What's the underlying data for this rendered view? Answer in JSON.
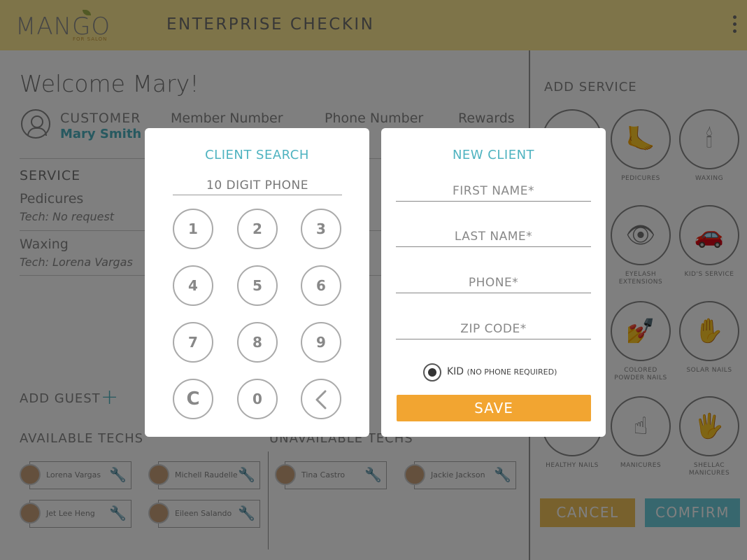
{
  "header": {
    "logo_text": "MANGO",
    "logo_sub": "FOR SALON",
    "title": "ENTERPRISE CHECKIN",
    "menu_icon": "kebab-menu-icon"
  },
  "main": {
    "welcome": "Welcome Mary!",
    "customer_label": "CUSTOMER",
    "customer_name": "Mary Smith",
    "columns": [
      "Member Number",
      "Phone Number",
      "Rewards"
    ],
    "service_header": "SERVICE",
    "services": [
      {
        "name": "Pedicures",
        "tech": "Tech: No request"
      },
      {
        "name": "Waxing",
        "tech": "Tech: Lorena Vargas"
      }
    ],
    "add_guest": "ADD GUEST",
    "add_guest_icon": "plus-icon",
    "available_header": "AVAILABLE TECHS",
    "unavailable_header": "UNAVAILABLE TECHS",
    "available_techs": [
      "Lorena Vargas",
      "Michell Raudelle",
      "Jet Lee Heng",
      "Eileen Salando"
    ],
    "unavailable_techs": [
      "Tina Castro",
      "Jackie Jackson"
    ]
  },
  "right_panel": {
    "title": "ADD SERVICE",
    "services": [
      {
        "label": "",
        "icon": "no-service-icon"
      },
      {
        "label": "PEDICURES",
        "icon": "foot-icon"
      },
      {
        "label": "WAXING",
        "icon": "wax-icon"
      },
      {
        "label": "",
        "icon": "service-icon"
      },
      {
        "label": "EYELASH EXTENSIONS",
        "icon": "eyelash-icon"
      },
      {
        "label": "KID'S SERVICE",
        "icon": "kid-icon"
      },
      {
        "label": "",
        "icon": "service-icon"
      },
      {
        "label": "COLORED POWDER NAILS",
        "icon": "powder-icon"
      },
      {
        "label": "SOLAR NAILS",
        "icon": "solar-nails-icon"
      },
      {
        "label": "HEALTHY NAILS",
        "icon": "healthy-nails-icon"
      },
      {
        "label": "MANICURES",
        "icon": "manicure-icon"
      },
      {
        "label": "SHELLAC MANICURES",
        "icon": "shellac-icon"
      }
    ],
    "cancel_label": "CANCEL",
    "confirm_label": "COMFIRM"
  },
  "client_search": {
    "title": "CLIENT SEARCH",
    "placeholder": "10 DIGIT PHONE",
    "keys": [
      "1",
      "2",
      "3",
      "4",
      "5",
      "6",
      "7",
      "8",
      "9",
      "C",
      "0"
    ],
    "back_icon": "chevron-left-icon"
  },
  "new_client": {
    "title": "NEW CLIENT",
    "first_name_placeholder": "FIRST NAME*",
    "last_name_placeholder": "LAST NAME*",
    "phone_placeholder": "PHONE*",
    "zip_placeholder": "ZIP CODE*",
    "kid_label": "KID",
    "kid_note": "(NO PHONE REQUIRED)",
    "save_label": "SAVE"
  },
  "colors": {
    "header_bg": "#fde993",
    "accent_teal": "#4fb3c0",
    "save_orange": "#f2a531",
    "cancel_yellow": "#f1c35a",
    "confirm_teal": "#6fcfdc"
  }
}
